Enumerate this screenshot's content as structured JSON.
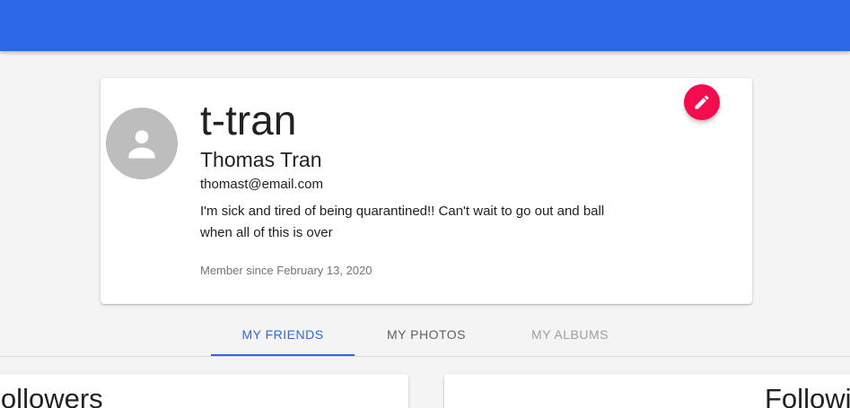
{
  "theme": {
    "primary": "#2c67e8",
    "accent": "#f50c4d",
    "background": "#f4f4f4"
  },
  "profile": {
    "username": "t-tran",
    "full_name": "Thomas Tran",
    "email": "thomast@email.com",
    "bio": "I'm sick and tired of being quarantined!! Can't wait to go out and ball when all of this is over",
    "member_since": "Member since February 13, 2020",
    "avatar_icon": "person-icon",
    "edit_icon": "pencil-icon"
  },
  "tabs": [
    {
      "label": "MY FRIENDS",
      "active": true
    },
    {
      "label": "MY PHOTOS",
      "active": false
    },
    {
      "label": "MY ALBUMS",
      "active": false
    }
  ],
  "panels": {
    "left_title": "Followers",
    "right_title": "Following"
  }
}
